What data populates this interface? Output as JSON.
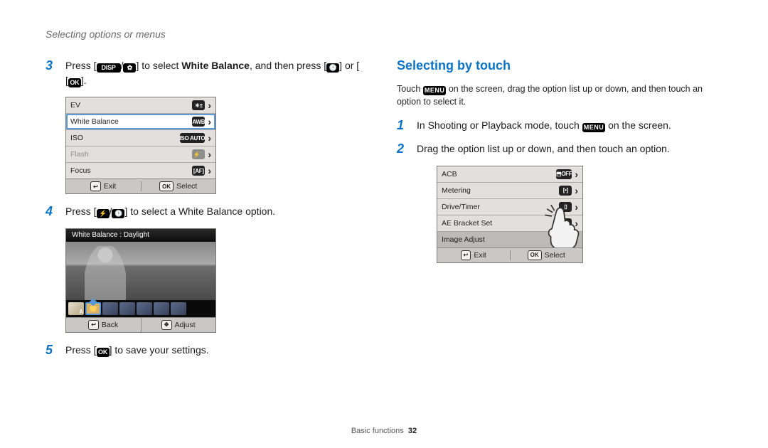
{
  "running_head": "Selecting options or menus",
  "left": {
    "steps": {
      "3": {
        "pre": "Press [",
        "g1": "DISP",
        "slash1": "/",
        "g2": "✿",
        "mid1": "] to select ",
        "bold": "White Balance",
        "mid2": ", and then press [",
        "g3": "🕒",
        "mid3": "] or [",
        "g4": "OK",
        "end": "]."
      },
      "4": {
        "pre": "Press [",
        "g1": "⚡",
        "slash": "/",
        "g2": "🕒",
        "end": "] to select a White Balance option."
      },
      "5": {
        "pre": "Press [",
        "g1": "OK",
        "end": "] to save your settings."
      }
    },
    "lcd": {
      "rows": [
        {
          "label": "EV",
          "chip": "☀±",
          "selected": false,
          "muted": false
        },
        {
          "label": "White Balance",
          "chip": "AWB",
          "selected": true,
          "muted": false
        },
        {
          "label": "ISO",
          "chip": "ISO\nAUTO",
          "selected": false,
          "muted": false
        },
        {
          "label": "Flash",
          "chip": "⚡A",
          "selected": false,
          "muted": true
        },
        {
          "label": "Focus",
          "chip": "[AF]",
          "selected": false,
          "muted": false
        }
      ],
      "bar": {
        "left_key": "↩",
        "left_label": "Exit",
        "right_key": "OK",
        "right_label": "Select"
      }
    },
    "wb": {
      "title": "White Balance : Daylight",
      "bar": {
        "left_key": "↩",
        "left_label": "Back",
        "right_key": "✥",
        "right_label": "Adjust"
      }
    }
  },
  "right": {
    "heading": "Selecting by touch",
    "intro": {
      "pre": "Touch ",
      "g": "MENU",
      "post": " on the screen, drag the option list up or down, and then touch an option to select it."
    },
    "steps": {
      "1": {
        "pre": "In Shooting or Playback mode, touch ",
        "g": "MENU",
        "post": " on the screen."
      },
      "2": {
        "text": "Drag the option list up or down, and then touch an option."
      }
    },
    "lcd": {
      "rows": [
        {
          "label": "ACB",
          "chip": "⬒OFF"
        },
        {
          "label": "Metering",
          "chip": "[•]"
        },
        {
          "label": "Drive/Timer",
          "chip": "▯"
        },
        {
          "label": "AE Bracket Set",
          "chip": "±.3"
        },
        {
          "label": "Image Adjust",
          "chip": ""
        }
      ],
      "bar": {
        "left_key": "↩",
        "left_label": "Exit",
        "right_key": "OK",
        "right_label": "Select"
      }
    }
  },
  "footer": {
    "section": "Basic functions",
    "page": "32"
  }
}
